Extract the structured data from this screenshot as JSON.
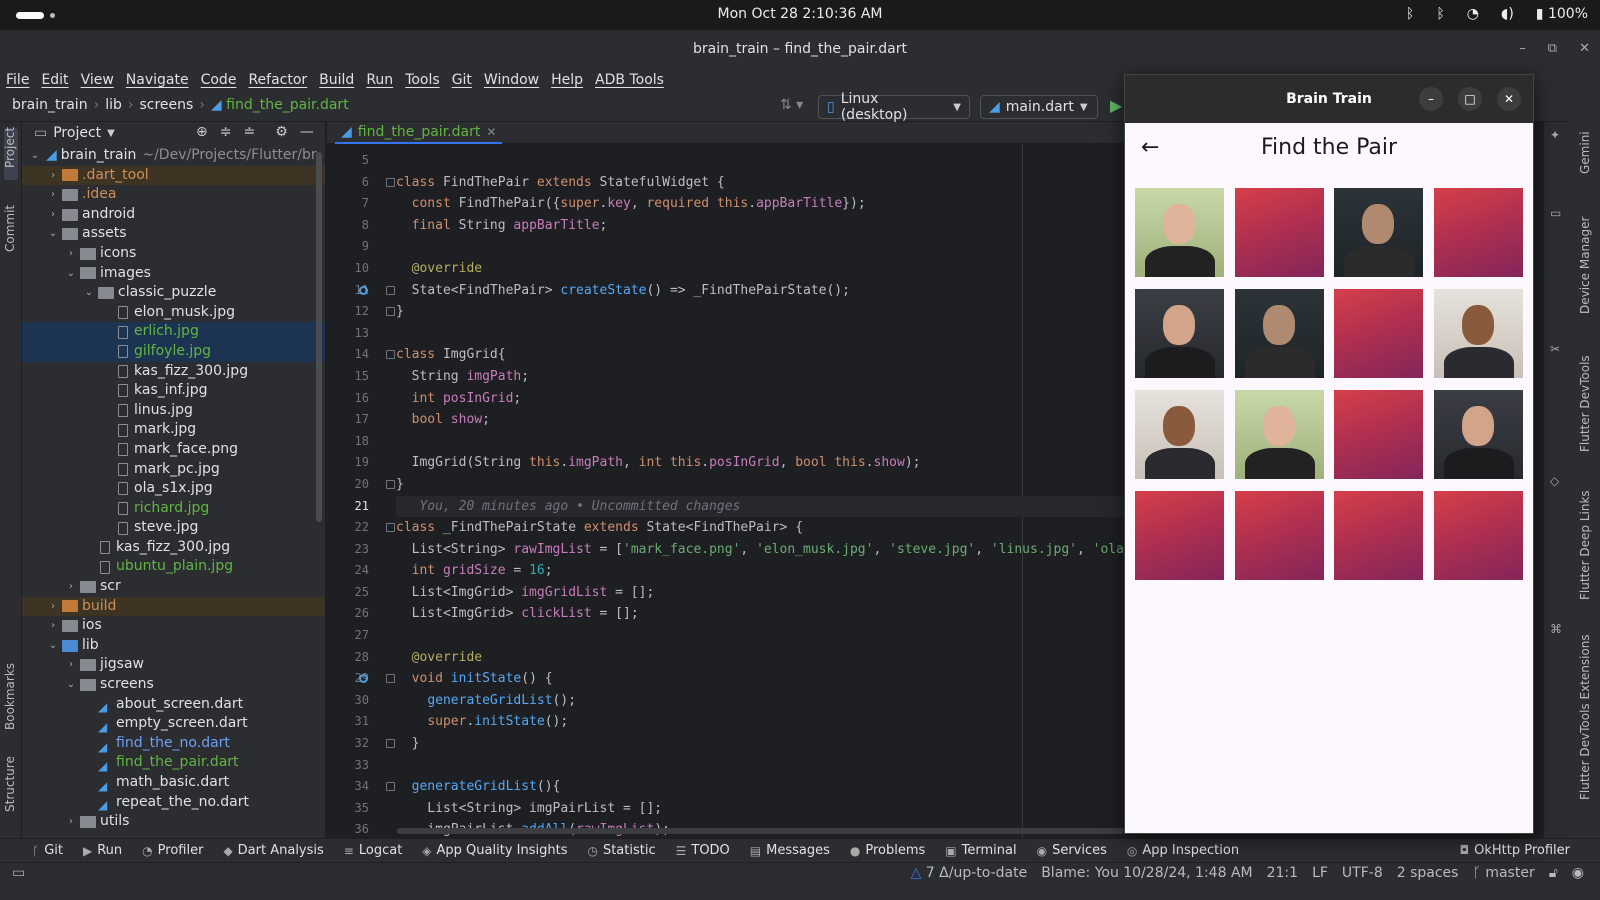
{
  "topbar": {
    "clock": "Mon Oct 28    2:10:36 AM",
    "battery": "100%"
  },
  "ide": {
    "window_title": "brain_train – find_the_pair.dart",
    "menu": [
      "File",
      "Edit",
      "View",
      "Navigate",
      "Code",
      "Refactor",
      "Build",
      "Run",
      "Tools",
      "Git",
      "Window",
      "Help",
      "ADB Tools"
    ],
    "breadcrumb": {
      "project": "brain_train",
      "dir1": "lib",
      "dir2": "screens",
      "file": "find_the_pair.dart"
    },
    "device": "Linux (desktop)",
    "run_config": "main.dart"
  },
  "left_strip": {
    "project": "Project",
    "commit": "Commit",
    "bookmarks": "Bookmarks",
    "structure": "Structure"
  },
  "project_panel": {
    "title": "Project",
    "root": "brain_train",
    "root_path": "~/Dev/Projects/Flutter/br",
    "items": [
      {
        "label": ".dart_tool",
        "indent": 1,
        "arrow": "›",
        "icon": "folder-orange",
        "color": "c-orange",
        "row": "excl"
      },
      {
        "label": ".idea",
        "indent": 1,
        "arrow": "›",
        "icon": "folder",
        "color": "c-orange",
        "row": ""
      },
      {
        "label": "android",
        "indent": 1,
        "arrow": "›",
        "icon": "folder",
        "color": "c-default",
        "row": ""
      },
      {
        "label": "assets",
        "indent": 1,
        "arrow": "⌄",
        "icon": "folder",
        "color": "c-default",
        "row": ""
      },
      {
        "label": "icons",
        "indent": 2,
        "arrow": "›",
        "icon": "folder",
        "color": "c-default",
        "row": ""
      },
      {
        "label": "images",
        "indent": 2,
        "arrow": "⌄",
        "icon": "folder",
        "color": "c-default",
        "row": ""
      },
      {
        "label": "classic_puzzle",
        "indent": 3,
        "arrow": "⌄",
        "icon": "folder",
        "color": "c-default",
        "row": ""
      },
      {
        "label": "elon_musk.jpg",
        "indent": 4,
        "arrow": "",
        "icon": "file",
        "color": "c-default",
        "row": ""
      },
      {
        "label": "erlich.jpg",
        "indent": 4,
        "arrow": "",
        "icon": "file",
        "color": "c-green",
        "row": "sel"
      },
      {
        "label": "gilfoyle.jpg",
        "indent": 4,
        "arrow": "",
        "icon": "file",
        "color": "c-green",
        "row": "sel"
      },
      {
        "label": "kas_fizz_300.jpg",
        "indent": 4,
        "arrow": "",
        "icon": "file",
        "color": "c-default",
        "row": ""
      },
      {
        "label": "kas_inf.jpg",
        "indent": 4,
        "arrow": "",
        "icon": "file",
        "color": "c-default",
        "row": ""
      },
      {
        "label": "linus.jpg",
        "indent": 4,
        "arrow": "",
        "icon": "file",
        "color": "c-default",
        "row": ""
      },
      {
        "label": "mark.jpg",
        "indent": 4,
        "arrow": "",
        "icon": "file",
        "color": "c-default",
        "row": ""
      },
      {
        "label": "mark_face.png",
        "indent": 4,
        "arrow": "",
        "icon": "file",
        "color": "c-default",
        "row": ""
      },
      {
        "label": "mark_pc.jpg",
        "indent": 4,
        "arrow": "",
        "icon": "file",
        "color": "c-default",
        "row": ""
      },
      {
        "label": "ola_s1x.jpg",
        "indent": 4,
        "arrow": "",
        "icon": "file",
        "color": "c-default",
        "row": ""
      },
      {
        "label": "richard.jpg",
        "indent": 4,
        "arrow": "",
        "icon": "file",
        "color": "c-green",
        "row": ""
      },
      {
        "label": "steve.jpg",
        "indent": 4,
        "arrow": "",
        "icon": "file",
        "color": "c-default",
        "row": ""
      },
      {
        "label": "kas_fizz_300.jpg",
        "indent": 3,
        "arrow": "",
        "icon": "file",
        "color": "c-default",
        "row": ""
      },
      {
        "label": "ubuntu_plain.jpg",
        "indent": 3,
        "arrow": "",
        "icon": "file",
        "color": "c-green",
        "row": ""
      },
      {
        "label": "scr",
        "indent": 2,
        "arrow": "›",
        "icon": "folder",
        "color": "c-default",
        "row": ""
      },
      {
        "label": "build",
        "indent": 1,
        "arrow": "›",
        "icon": "folder-orange",
        "color": "c-orange",
        "row": "excl"
      },
      {
        "label": "ios",
        "indent": 1,
        "arrow": "›",
        "icon": "folder",
        "color": "c-default",
        "row": ""
      },
      {
        "label": "lib",
        "indent": 1,
        "arrow": "⌄",
        "icon": "folder-blue",
        "color": "c-default",
        "row": ""
      },
      {
        "label": "jigsaw",
        "indent": 2,
        "arrow": "›",
        "icon": "folder",
        "color": "c-default",
        "row": ""
      },
      {
        "label": "screens",
        "indent": 2,
        "arrow": "⌄",
        "icon": "folder",
        "color": "c-default",
        "row": ""
      },
      {
        "label": "about_screen.dart",
        "indent": 3,
        "arrow": "",
        "icon": "dart",
        "color": "c-default",
        "row": ""
      },
      {
        "label": "empty_screen.dart",
        "indent": 3,
        "arrow": "",
        "icon": "dart",
        "color": "c-default",
        "row": ""
      },
      {
        "label": "find_the_no.dart",
        "indent": 3,
        "arrow": "",
        "icon": "dart",
        "color": "c-blue",
        "row": ""
      },
      {
        "label": "find_the_pair.dart",
        "indent": 3,
        "arrow": "",
        "icon": "dart",
        "color": "c-green",
        "row": ""
      },
      {
        "label": "math_basic.dart",
        "indent": 3,
        "arrow": "",
        "icon": "dart",
        "color": "c-default",
        "row": ""
      },
      {
        "label": "repeat_the_no.dart",
        "indent": 3,
        "arrow": "",
        "icon": "dart",
        "color": "c-default",
        "row": ""
      },
      {
        "label": "utils",
        "indent": 2,
        "arrow": "›",
        "icon": "folder",
        "color": "c-default",
        "row": ""
      }
    ]
  },
  "editor": {
    "tab": "find_the_pair.dart",
    "first_line_number": 5,
    "current_line": 21,
    "lines": [
      "",
      "class FindThePair extends StatefulWidget {",
      "  const FindThePair({super.key, required this.appBarTitle});",
      "  final String appBarTitle;",
      "",
      "  @override",
      "  State<FindThePair> createState() => _FindThePairState();",
      "}",
      "",
      "class ImgGrid{",
      "  String imgPath;",
      "  int posInGrid;",
      "  bool show;",
      "",
      "  ImgGrid(String this.imgPath, int this.posInGrid, bool this.show);",
      "}",
      "   You, 20 minutes ago • Uncommitted changes",
      "class _FindThePairState extends State<FindThePair> {",
      "  List<String> rawImgList = ['mark_face.png', 'elon_musk.jpg', 'steve.jpg', 'linus.jpg', 'ola",
      "  int gridSize = 16;",
      "  List<ImgGrid> imgGridList = [];",
      "  List<ImgGrid> clickList = [];",
      "",
      "  @override",
      "  void initState() {",
      "    generateGridList();",
      "    super.initState();",
      "  }",
      "",
      "  generateGridList(){",
      "    List<String> imgPairList = [];",
      "    imgPairList.addAll(rawImgList);"
    ]
  },
  "right_strip": [
    "Gemini",
    "Device Manager",
    "Flutter DevTools",
    "Flutter Deep Links",
    "Flutter DevTools Extensions"
  ],
  "bottom_tools": [
    "Git",
    "Run",
    "Profiler",
    "Dart Analysis",
    "Logcat",
    "App Quality Insights",
    "Statistic",
    "TODO",
    "Messages",
    "Problems",
    "Terminal",
    "Services",
    "App Inspection"
  ],
  "bottom_right_tool": "OkHttp Profiler",
  "status": {
    "vcs": "7 Δ/up-to-date",
    "blame": "Blame: You 10/28/24, 1:48 AM",
    "position": "21:1",
    "line_sep": "LF",
    "encoding": "UTF-8",
    "indent": "2 spaces",
    "branch": "master"
  },
  "app": {
    "window_title": "Brain Train",
    "page_title": "Find the Pair",
    "tiles": [
      {
        "kind": "photo",
        "person": "linus"
      },
      {
        "kind": "plain"
      },
      {
        "kind": "photo",
        "person": "gilfoyle"
      },
      {
        "kind": "plain"
      },
      {
        "kind": "photo",
        "person": "elon"
      },
      {
        "kind": "photo",
        "person": "gilfoyle"
      },
      {
        "kind": "plain"
      },
      {
        "kind": "photo",
        "person": "kas"
      },
      {
        "kind": "photo",
        "person": "kas"
      },
      {
        "kind": "photo",
        "person": "linus"
      },
      {
        "kind": "plain"
      },
      {
        "kind": "photo",
        "person": "elon"
      },
      {
        "kind": "plain"
      },
      {
        "kind": "plain"
      },
      {
        "kind": "plain"
      },
      {
        "kind": "plain"
      }
    ]
  }
}
